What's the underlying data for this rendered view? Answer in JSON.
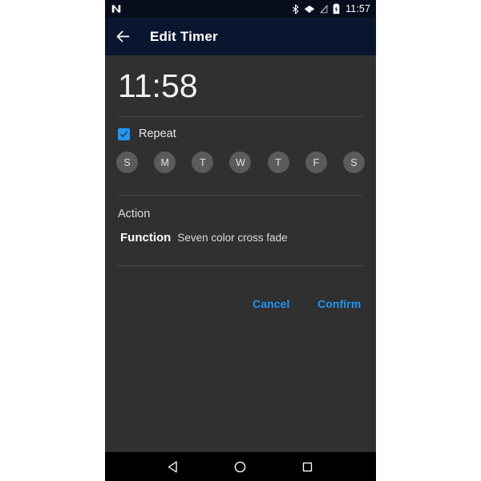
{
  "status_bar": {
    "logo": "android-n-logo",
    "icons": [
      "bluetooth-icon",
      "wifi-no-internet-icon",
      "cellular-off-icon",
      "battery-charging-icon"
    ],
    "clock": "11:57",
    "background_color": "#070d1c"
  },
  "app_bar": {
    "back_icon": "back-arrow-icon",
    "title": "Edit Timer",
    "background_color": "#0a1530"
  },
  "timer": {
    "time": "11:58"
  },
  "repeat": {
    "label": "Repeat",
    "checked": true,
    "checkbox_color": "#2196f3",
    "days": [
      {
        "label": "S",
        "name": "sunday",
        "selected": false
      },
      {
        "label": "M",
        "name": "monday",
        "selected": false
      },
      {
        "label": "T",
        "name": "tuesday",
        "selected": false
      },
      {
        "label": "W",
        "name": "wednesday",
        "selected": false
      },
      {
        "label": "T",
        "name": "thursday",
        "selected": false
      },
      {
        "label": "F",
        "name": "friday",
        "selected": false
      },
      {
        "label": "S",
        "name": "saturday",
        "selected": false
      }
    ]
  },
  "action": {
    "section_label": "Action",
    "function_key": "Function",
    "function_value": "Seven color cross fade"
  },
  "buttons": {
    "cancel": "Cancel",
    "confirm": "Confirm",
    "accent_color": "#2196f3"
  },
  "nav_bar": {
    "back": "nav-back-icon",
    "home": "nav-home-icon",
    "recents": "nav-recents-icon"
  }
}
